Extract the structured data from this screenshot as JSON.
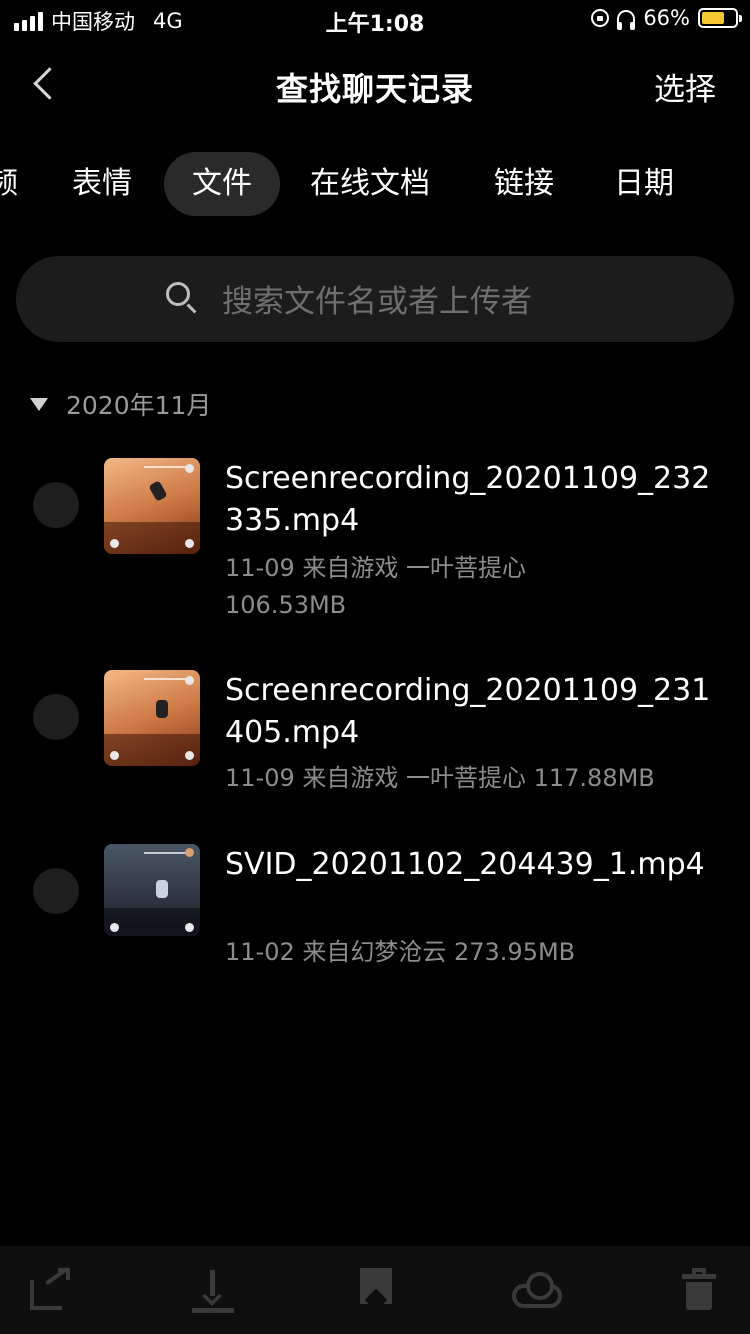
{
  "status_bar": {
    "carrier": "中国移动",
    "network": "4G",
    "time": "上午1:08",
    "battery": "66%",
    "battery_level": 0.66
  },
  "nav": {
    "title": "查找聊天记录",
    "select_label": "选择"
  },
  "tabs": [
    {
      "label": "频"
    },
    {
      "label": "表情"
    },
    {
      "label": "文件"
    },
    {
      "label": "在线文档"
    },
    {
      "label": "链接"
    },
    {
      "label": "日期"
    }
  ],
  "active_tab": "文件",
  "search": {
    "placeholder": "搜索文件名或者上传者"
  },
  "group": {
    "label": "2020年11月"
  },
  "files": [
    {
      "name": "Screenrecording_20201109_232335.mp4",
      "meta_line1": "11-09 来自游戏 一叶菩提心",
      "meta_line2": "106.53MB"
    },
    {
      "name": "Screenrecording_20201109_231405.mp4",
      "meta_line1": "11-09 来自游戏 一叶菩提心 117.88MB"
    },
    {
      "name": "SVID_20201102_204439_1.mp4",
      "meta_line1": "11-02 来自幻梦沧云 273.95MB"
    }
  ],
  "toolbar": {
    "icons": [
      "share-icon",
      "download-icon",
      "bookmark-icon",
      "cloud-icon",
      "trash-icon"
    ]
  }
}
